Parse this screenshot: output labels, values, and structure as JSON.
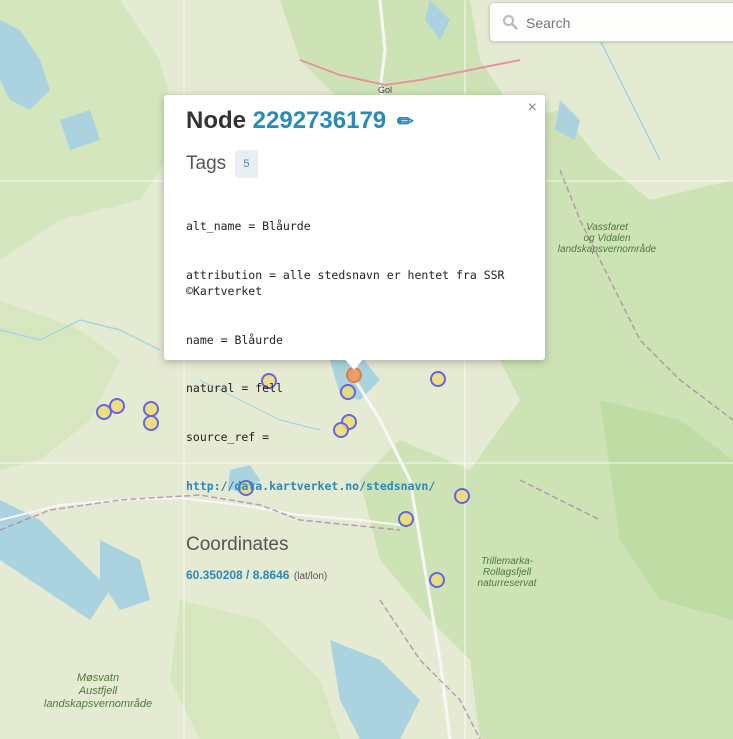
{
  "map": {
    "labels": {
      "gol": "Gol",
      "vassfaret": "Vassfaret\nog Vidalen\nlandskapsvernområde",
      "trillemarka": "Trillemarka-\nRollagsfjell\nnaturreservat",
      "mosvatn": "Møsvatn\nAustfjell\nlandskapsvernområde"
    }
  },
  "search": {
    "placeholder": "Search"
  },
  "popup": {
    "heading": "Node",
    "node_id": "2292736179",
    "edit_icon": "✏",
    "close_label": "×",
    "tags_title": "Tags",
    "tags_count": "5",
    "tags": [
      "alt_name = Blåurde",
      "attribution = alle stedsnavn er hentet fra SSR ©Kartverket",
      "name = Blåurde",
      "natural = fell",
      "source_ref ="
    ],
    "source_link": "http://data.kartverket.no/stedsnavn/",
    "coords_title": "Coordinates",
    "coords_value": "60.350208 / 8.8646",
    "coords_unit": "(lat/lon)"
  },
  "colors": {
    "link": "#2a8ab8",
    "marker_border": "#6367e0",
    "marker_fill": "#eedb77",
    "selected_marker": "#e07e4a"
  }
}
